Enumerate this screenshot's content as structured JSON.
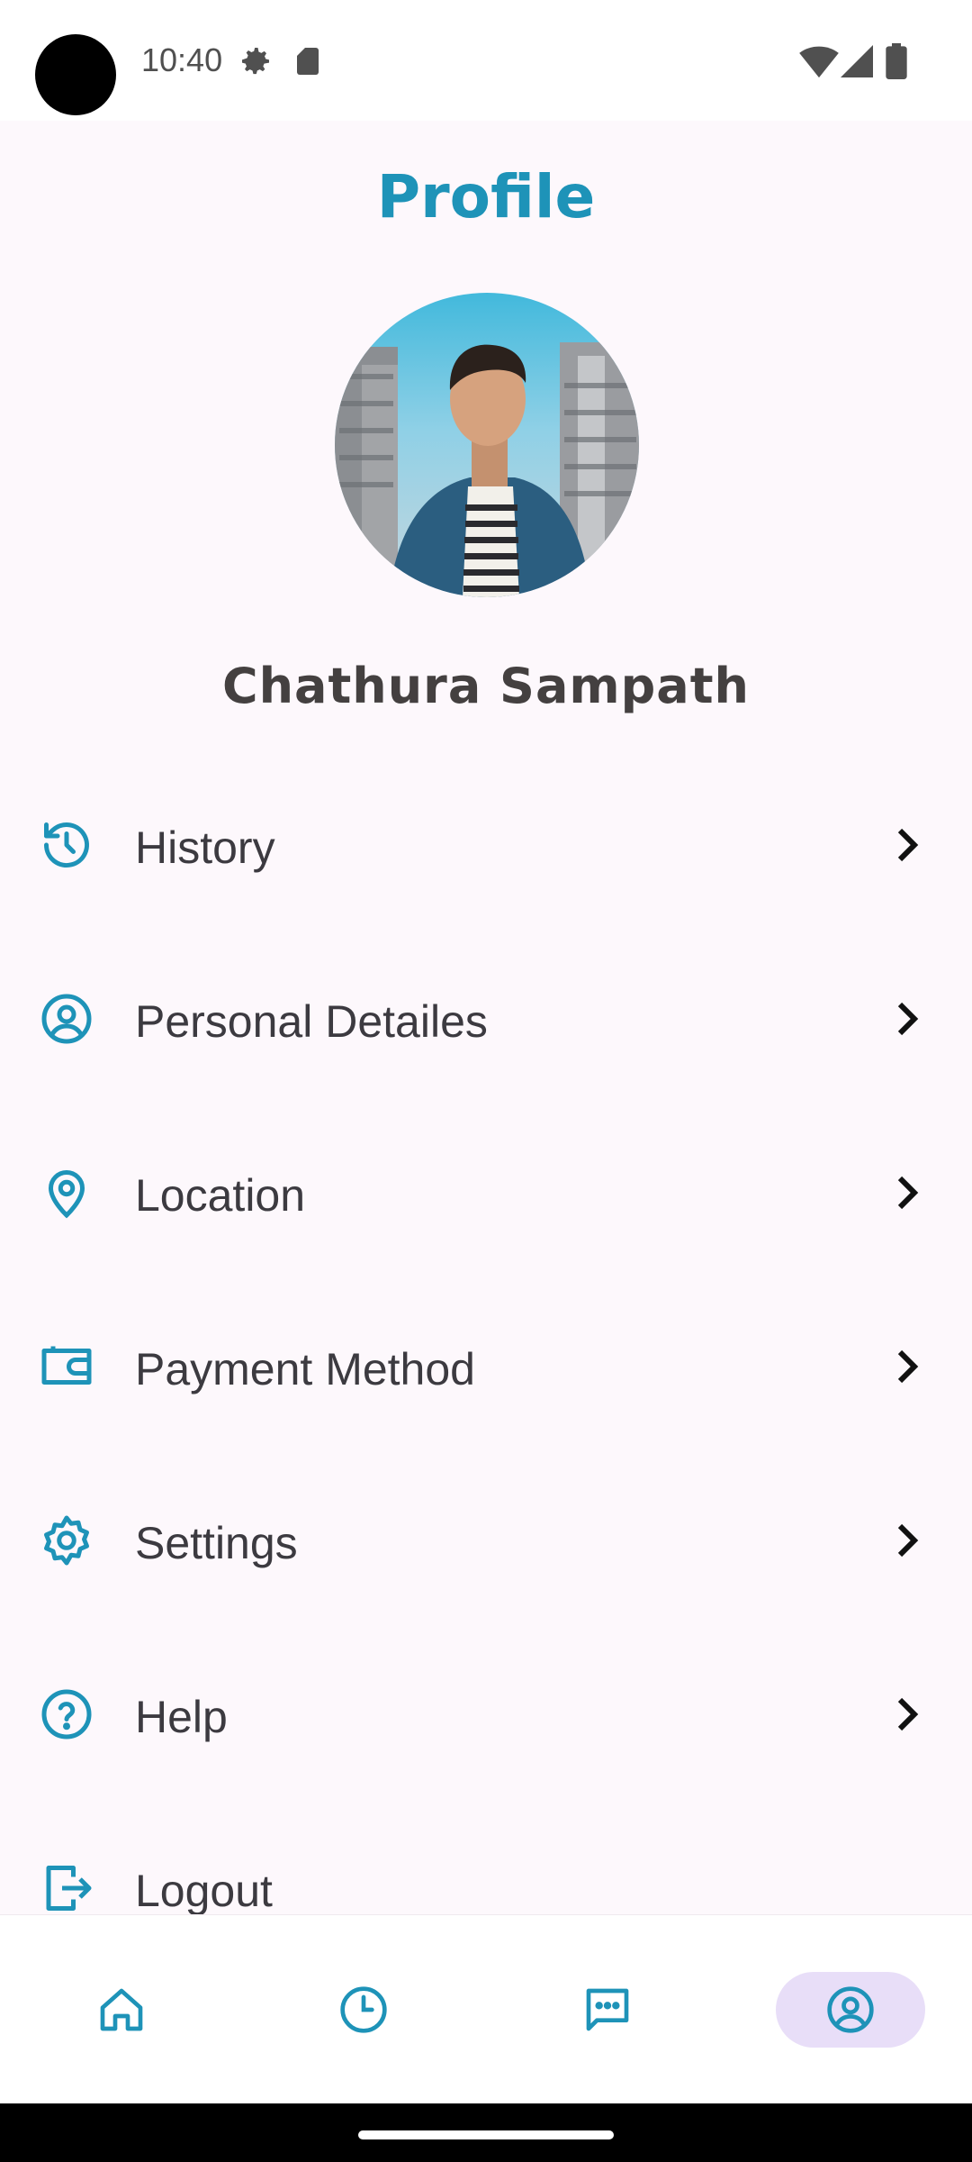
{
  "status_bar": {
    "time": "10:40",
    "left_icons": [
      "settings-icon",
      "sd-card-icon"
    ],
    "right_icons": [
      "wifi-icon",
      "signal-icon",
      "battery-icon"
    ]
  },
  "header": {
    "title": "Profile"
  },
  "profile": {
    "name": "Chathura Sampath",
    "avatar": "avatar-photo"
  },
  "menu": {
    "items": [
      {
        "label": "History",
        "icon": "history-icon"
      },
      {
        "label": "Personal Detailes",
        "icon": "account-circle-icon"
      },
      {
        "label": "Location",
        "icon": "location-pin-icon"
      },
      {
        "label": "Payment Method",
        "icon": "wallet-icon"
      },
      {
        "label": "Settings",
        "icon": "gear-icon"
      },
      {
        "label": "Help",
        "icon": "help-circle-icon"
      },
      {
        "label": "Logout",
        "icon": "logout-icon"
      }
    ]
  },
  "bottom_nav": {
    "items": [
      {
        "icon": "home-icon",
        "active": false
      },
      {
        "icon": "clock-icon",
        "active": false
      },
      {
        "icon": "chat-icon",
        "active": false
      },
      {
        "icon": "account-circle-icon",
        "active": true
      }
    ]
  },
  "colors": {
    "accent": "#1e93b8",
    "background": "#fdf8fc",
    "text": "#3c3a40",
    "active_nav_bg": "#e8def8"
  }
}
